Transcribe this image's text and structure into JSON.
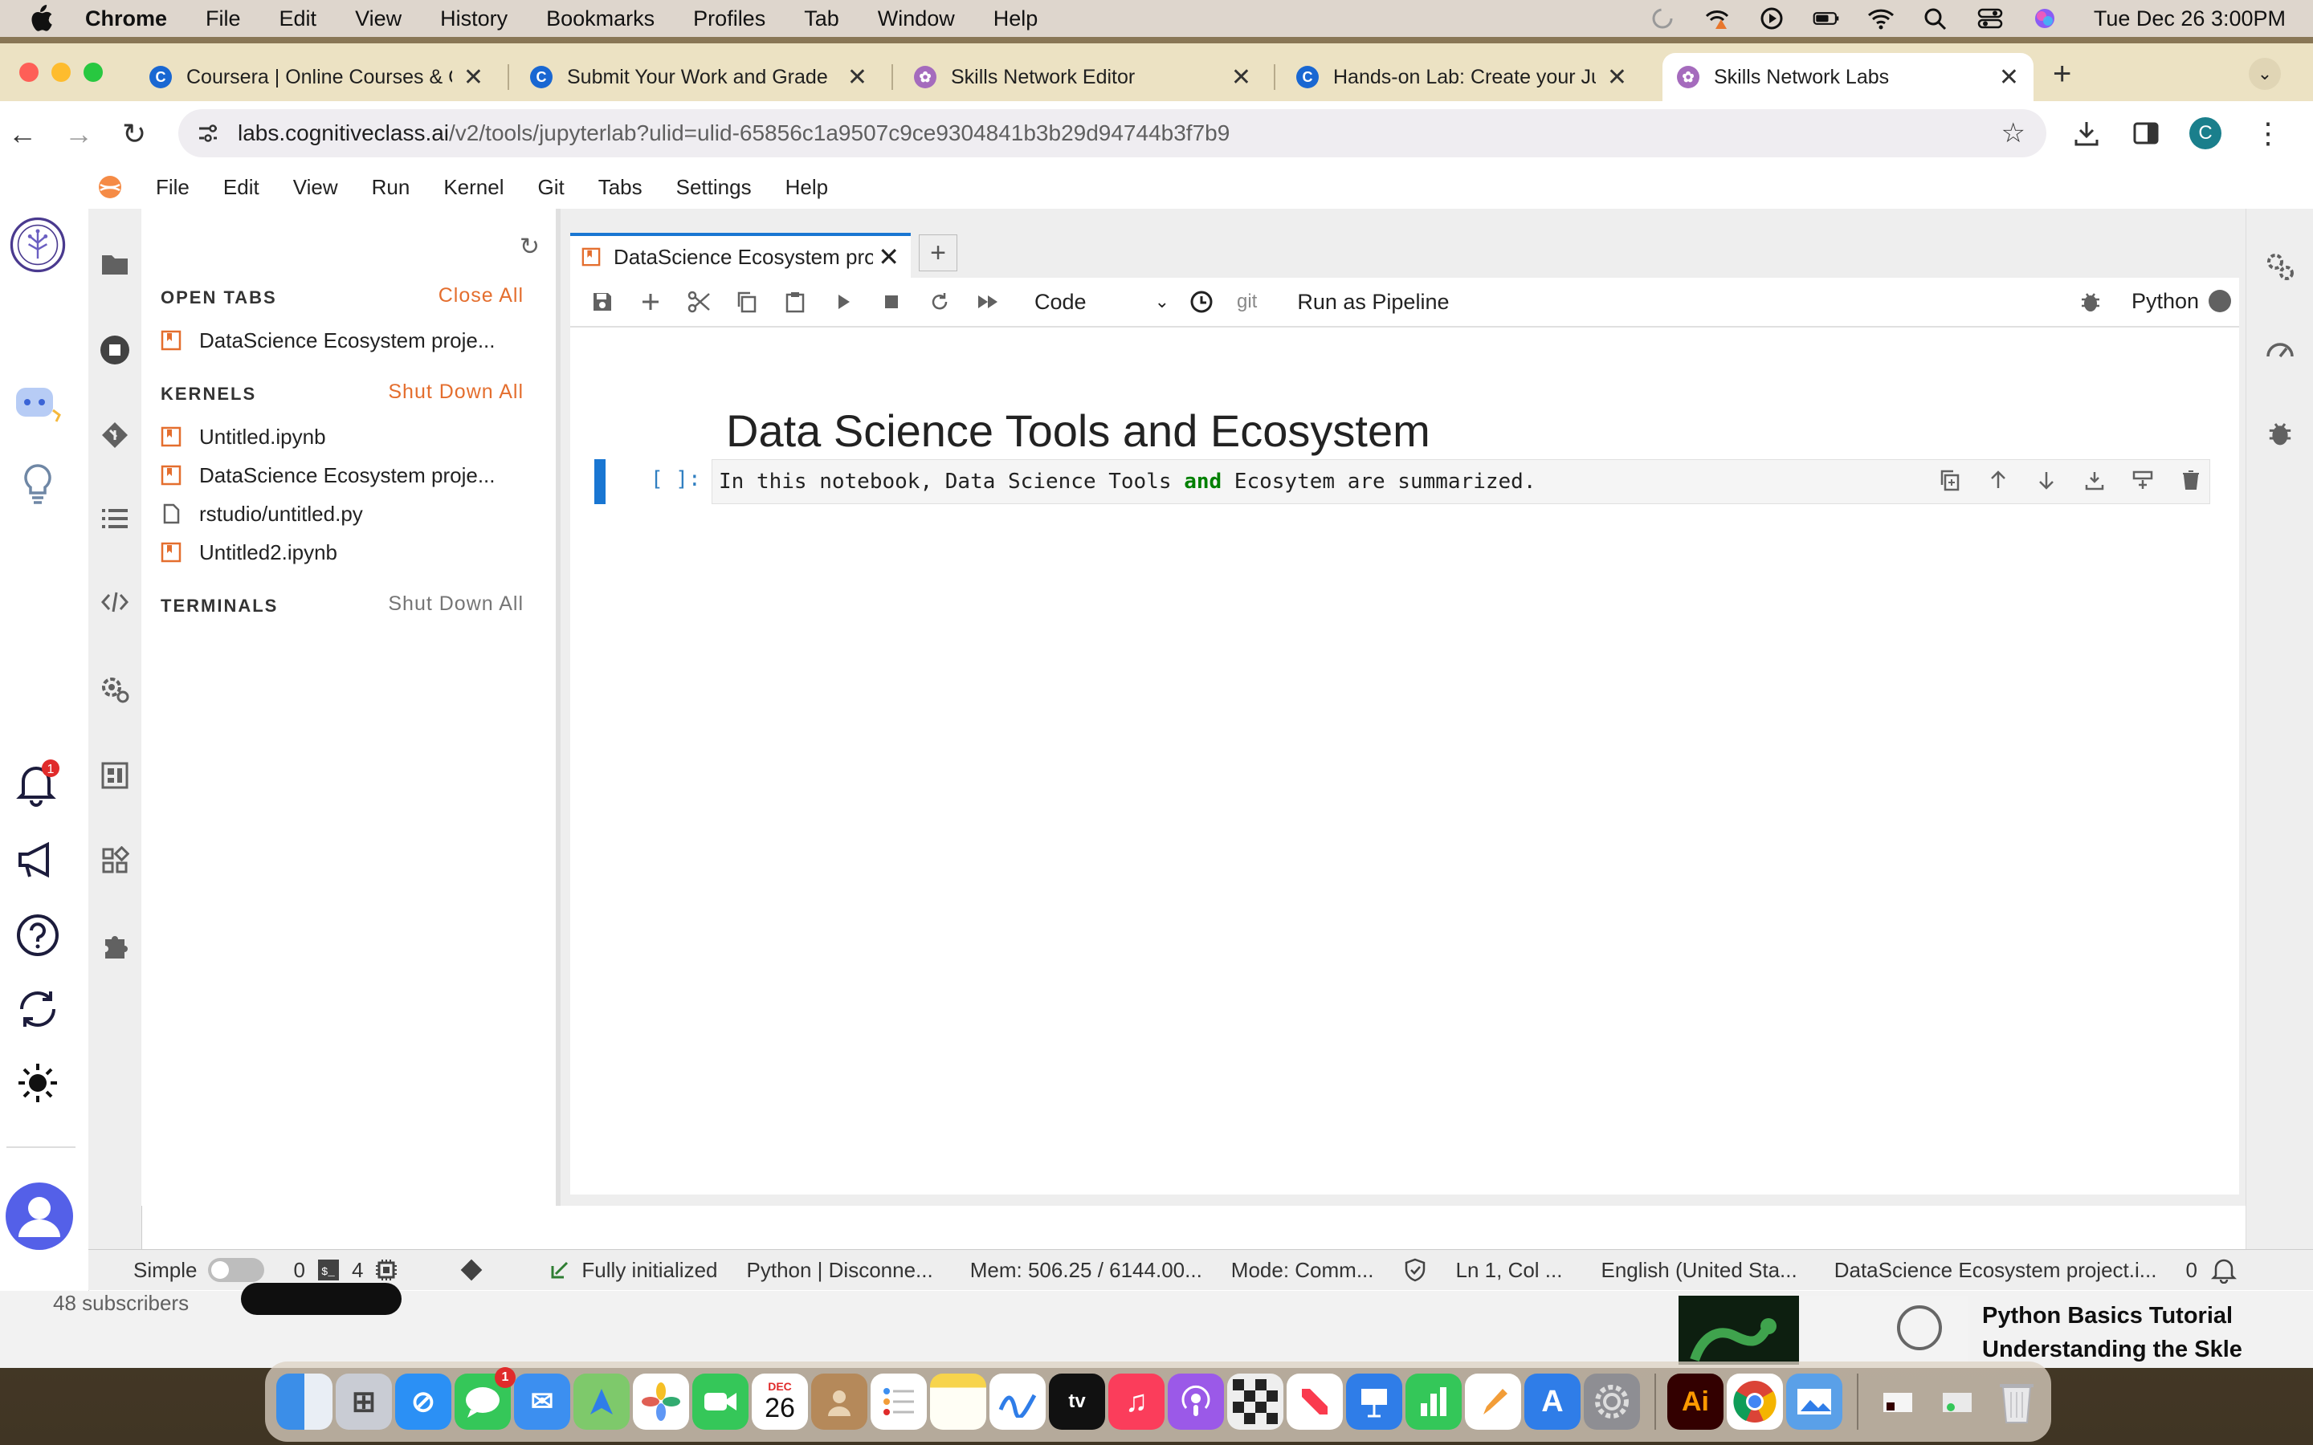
{
  "mac_menubar": {
    "app_name": "Chrome",
    "items": [
      "File",
      "Edit",
      "View",
      "History",
      "Bookmarks",
      "Profiles",
      "Tab",
      "Window",
      "Help"
    ],
    "clock": "Tue Dec 26  3:00PM"
  },
  "browser": {
    "tabs": [
      {
        "label": "Coursera | Online Courses & C",
        "favicon": "coursera",
        "color": "#1967d2"
      },
      {
        "label": "Submit Your Work and Grade",
        "favicon": "coursera",
        "color": "#1967d2"
      },
      {
        "label": "Skills Network Editor",
        "favicon": "skills-network",
        "color": "#a56bbd"
      },
      {
        "label": "Hands-on Lab: Create your Ju",
        "favicon": "coursera",
        "color": "#1967d2"
      },
      {
        "label": "Skills Network Labs",
        "favicon": "skills-network",
        "color": "#a56bbd"
      }
    ],
    "url_host": "labs.cognitiveclass.ai",
    "url_path": "/v2/tools/jupyterlab?ulid=ulid-65856c1a9507c9ce9304841b3b29d94744b3f7b9",
    "profile_initial": "C"
  },
  "jupyter": {
    "menu": [
      "File",
      "Edit",
      "View",
      "Run",
      "Kernel",
      "Git",
      "Tabs",
      "Settings",
      "Help"
    ],
    "notification_count": "1",
    "running_panel": {
      "open_tabs_header": "OPEN TABS",
      "close_all": "Close All",
      "open_tabs": [
        "DataScience Ecosystem proje..."
      ],
      "kernels_header": "KERNELS",
      "shut_down_all": "Shut Down All",
      "kernels": [
        {
          "name": "Untitled.ipynb",
          "icon": "notebook-icon"
        },
        {
          "name": "DataScience Ecosystem proje...",
          "icon": "notebook-icon"
        },
        {
          "name": "rstudio/untitled.py",
          "icon": "file-icon"
        },
        {
          "name": "Untitled2.ipynb",
          "icon": "notebook-icon"
        }
      ],
      "terminals_header": "TERMINALS",
      "terminals_shut_down_all": "Shut Down All"
    },
    "doc_tab": "DataScience Ecosystem proj",
    "toolbar": {
      "cell_type": "Code",
      "git": "git",
      "run_as_pipeline": "Run as Pipeline",
      "kernel": "Python"
    },
    "notebook": {
      "heading": "Data Science Tools and Ecosystem",
      "prompt": "[ ]:",
      "code_before": "In this notebook, Data Science Tools ",
      "code_keyword": "and",
      "code_after": " Ecosytem are summarized."
    },
    "statusbar": {
      "mode": "Simple",
      "count1": "0",
      "count2": "4",
      "status": "Fully initialized",
      "kernel": "Python | Disconne...",
      "mem": "Mem: 506.25 / 6144.00...",
      "cmd_mode": "Mode: Comm...",
      "position": "Ln 1, Col ...",
      "language": "English (United Sta...",
      "filename": "DataScience Ecosystem project.i...",
      "count3": "0"
    }
  },
  "background_page": {
    "subscribers": "48 subscribers",
    "video_title_1": "Python Basics Tutorial",
    "video_title_2": "Understanding the Skle"
  },
  "dock": {
    "calendar_month": "DEC",
    "calendar_day": "26",
    "messages_badge": "1"
  }
}
